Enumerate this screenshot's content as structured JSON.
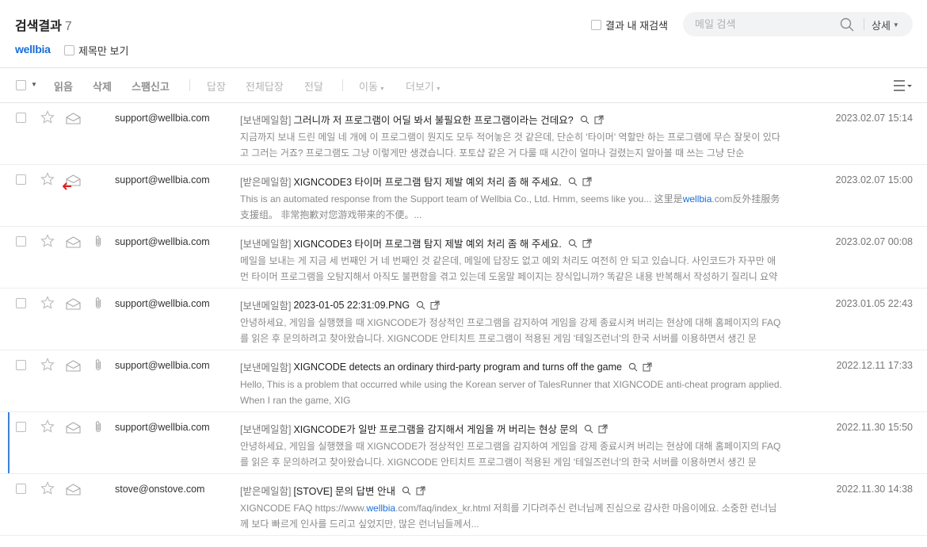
{
  "header": {
    "title": "검색결과",
    "count": "7",
    "brand": "wellbia",
    "subject_only_label": "제목만 보기",
    "rescan_label": "결과 내 재검색",
    "search_placeholder": "메일 검색",
    "detail_label": "상세"
  },
  "toolbar": {
    "read": "읽음",
    "delete": "삭제",
    "spam": "스팸신고",
    "reply": "답장",
    "reply_all": "전체답장",
    "forward": "전달",
    "move": "이동",
    "more": "더보기"
  },
  "emails": [
    {
      "sender": "support@wellbia.com",
      "folder": "[보낸메일함]",
      "subject": "그러니까 저 프로그램이 어딜 봐서 불필요한 프로그램이라는 건데요?",
      "preview": "지금까지 보내 드린 메일 네 개에 이 프로그램이 뭔지도 모두 적어놓은 것 같은데, 단순히 '타이머' 역할만 하는 프로그램에 무슨 잘못이 있다고 그러는 거죠? 프로그램도 그냥 이렇게만 생겼습니다. 포토샵 같은 거 다룰 때 시간이 얼마나 걸렸는지 알아볼 때 쓰는 그냥 단순",
      "preview_hl": "",
      "preview_after": "",
      "date": "2023.02.07 15:14"
    },
    {
      "sender": "support@wellbia.com",
      "folder": "[받은메일함]",
      "subject": "XIGNCODE3 타이머 프로그램 탐지 제발 예외 처리 좀 해 주세요.",
      "preview": "This is an automated response from the Support team of Wellbia Co., Ltd. Hmm, seems like you... 这里是",
      "preview_hl": "wellbia",
      "preview_after": ".com反外挂服务支援组。 非常抱歉对您游戏带来的不便。...",
      "date": "2023.02.07 15:00"
    },
    {
      "sender": "support@wellbia.com",
      "folder": "[보낸메일함]",
      "subject": "XIGNCODE3 타이머 프로그램 탐지 제발 예외 처리 좀 해 주세요.",
      "preview": "메일을 보내는 게 지금 세 번째인 거 네 번째인 것 같은데, 메일에 답장도 없고 예외 처리도 여전히 안 되고 있습니다. 사인코드가 자꾸만 애먼 타이머 프로그램을 오탐지해서 아직도 불편함을 겪고 있는데 도움말 페이지는 장식입니까? 똑같은 내용 반복해서 작성하기 질리니 요약",
      "preview_hl": "",
      "preview_after": "",
      "date": "2023.02.07 00:08"
    },
    {
      "sender": "support@wellbia.com",
      "folder": "[보낸메일함]",
      "subject": "2023-01-05 22:31:09.PNG",
      "preview": "안녕하세요, 게임을 실행했을 때 XIGNCODE가 정상적인 프로그램을 감지하여 게임을 강제 종료시켜 버리는 현상에 대해 홈페이지의 FAQ를 읽은 후 문의하려고 찾아왔습니다. XIGNCODE 안티치트 프로그램이 적용된 게임 '테일즈런너'의 한국 서버를 이용하면서 생긴 문",
      "preview_hl": "",
      "preview_after": "",
      "date": "2023.01.05 22:43"
    },
    {
      "sender": "support@wellbia.com",
      "folder": "[보낸메일함]",
      "subject": "XIGNCODE detects an ordinary third-party program and turns off the game",
      "preview": "Hello, This is a problem that occurred while using the Korean server of TalesRunner that XIGNCODE anti-cheat program applied. When I ran the game, XIG",
      "preview_hl": "",
      "preview_after": "",
      "date": "2022.12.11 17:33"
    },
    {
      "sender": "support@wellbia.com",
      "folder": "[보낸메일함]",
      "subject": "XIGNCODE가 일반 프로그램을 감지해서 게임을 꺼 버리는 현상 문의",
      "preview": "안녕하세요, 게임을 실행했을 때 XIGNCODE가 정상적인 프로그램을 감지하여 게임을 강제 종료시켜 버리는 현상에 대해 홈페이지의 FAQ를 읽은 후 문의하려고 찾아왔습니다. XIGNCODE 안티치트 프로그램이 적용된 게임 '테일즈런너'의 한국 서버를 이용하면서 생긴 문",
      "preview_hl": "",
      "preview_after": "",
      "date": "2022.11.30 15:50"
    },
    {
      "sender": "stove@onstove.com",
      "folder": "[받은메일함]",
      "subject": "[STOVE] 문의 답변 안내",
      "preview": "XIGNCODE FAQ https://www.",
      "preview_hl": "wellbia",
      "preview_after": ".com/faq/index_kr.html 저희를 기다려주신 런너님께 진심으로 감사한 마음이에요. 소중한 런너님께 보다 빠르게 인사를 드리고 싶었지만, 많은 런너님들께서...",
      "date": "2022.11.30 14:38"
    }
  ]
}
